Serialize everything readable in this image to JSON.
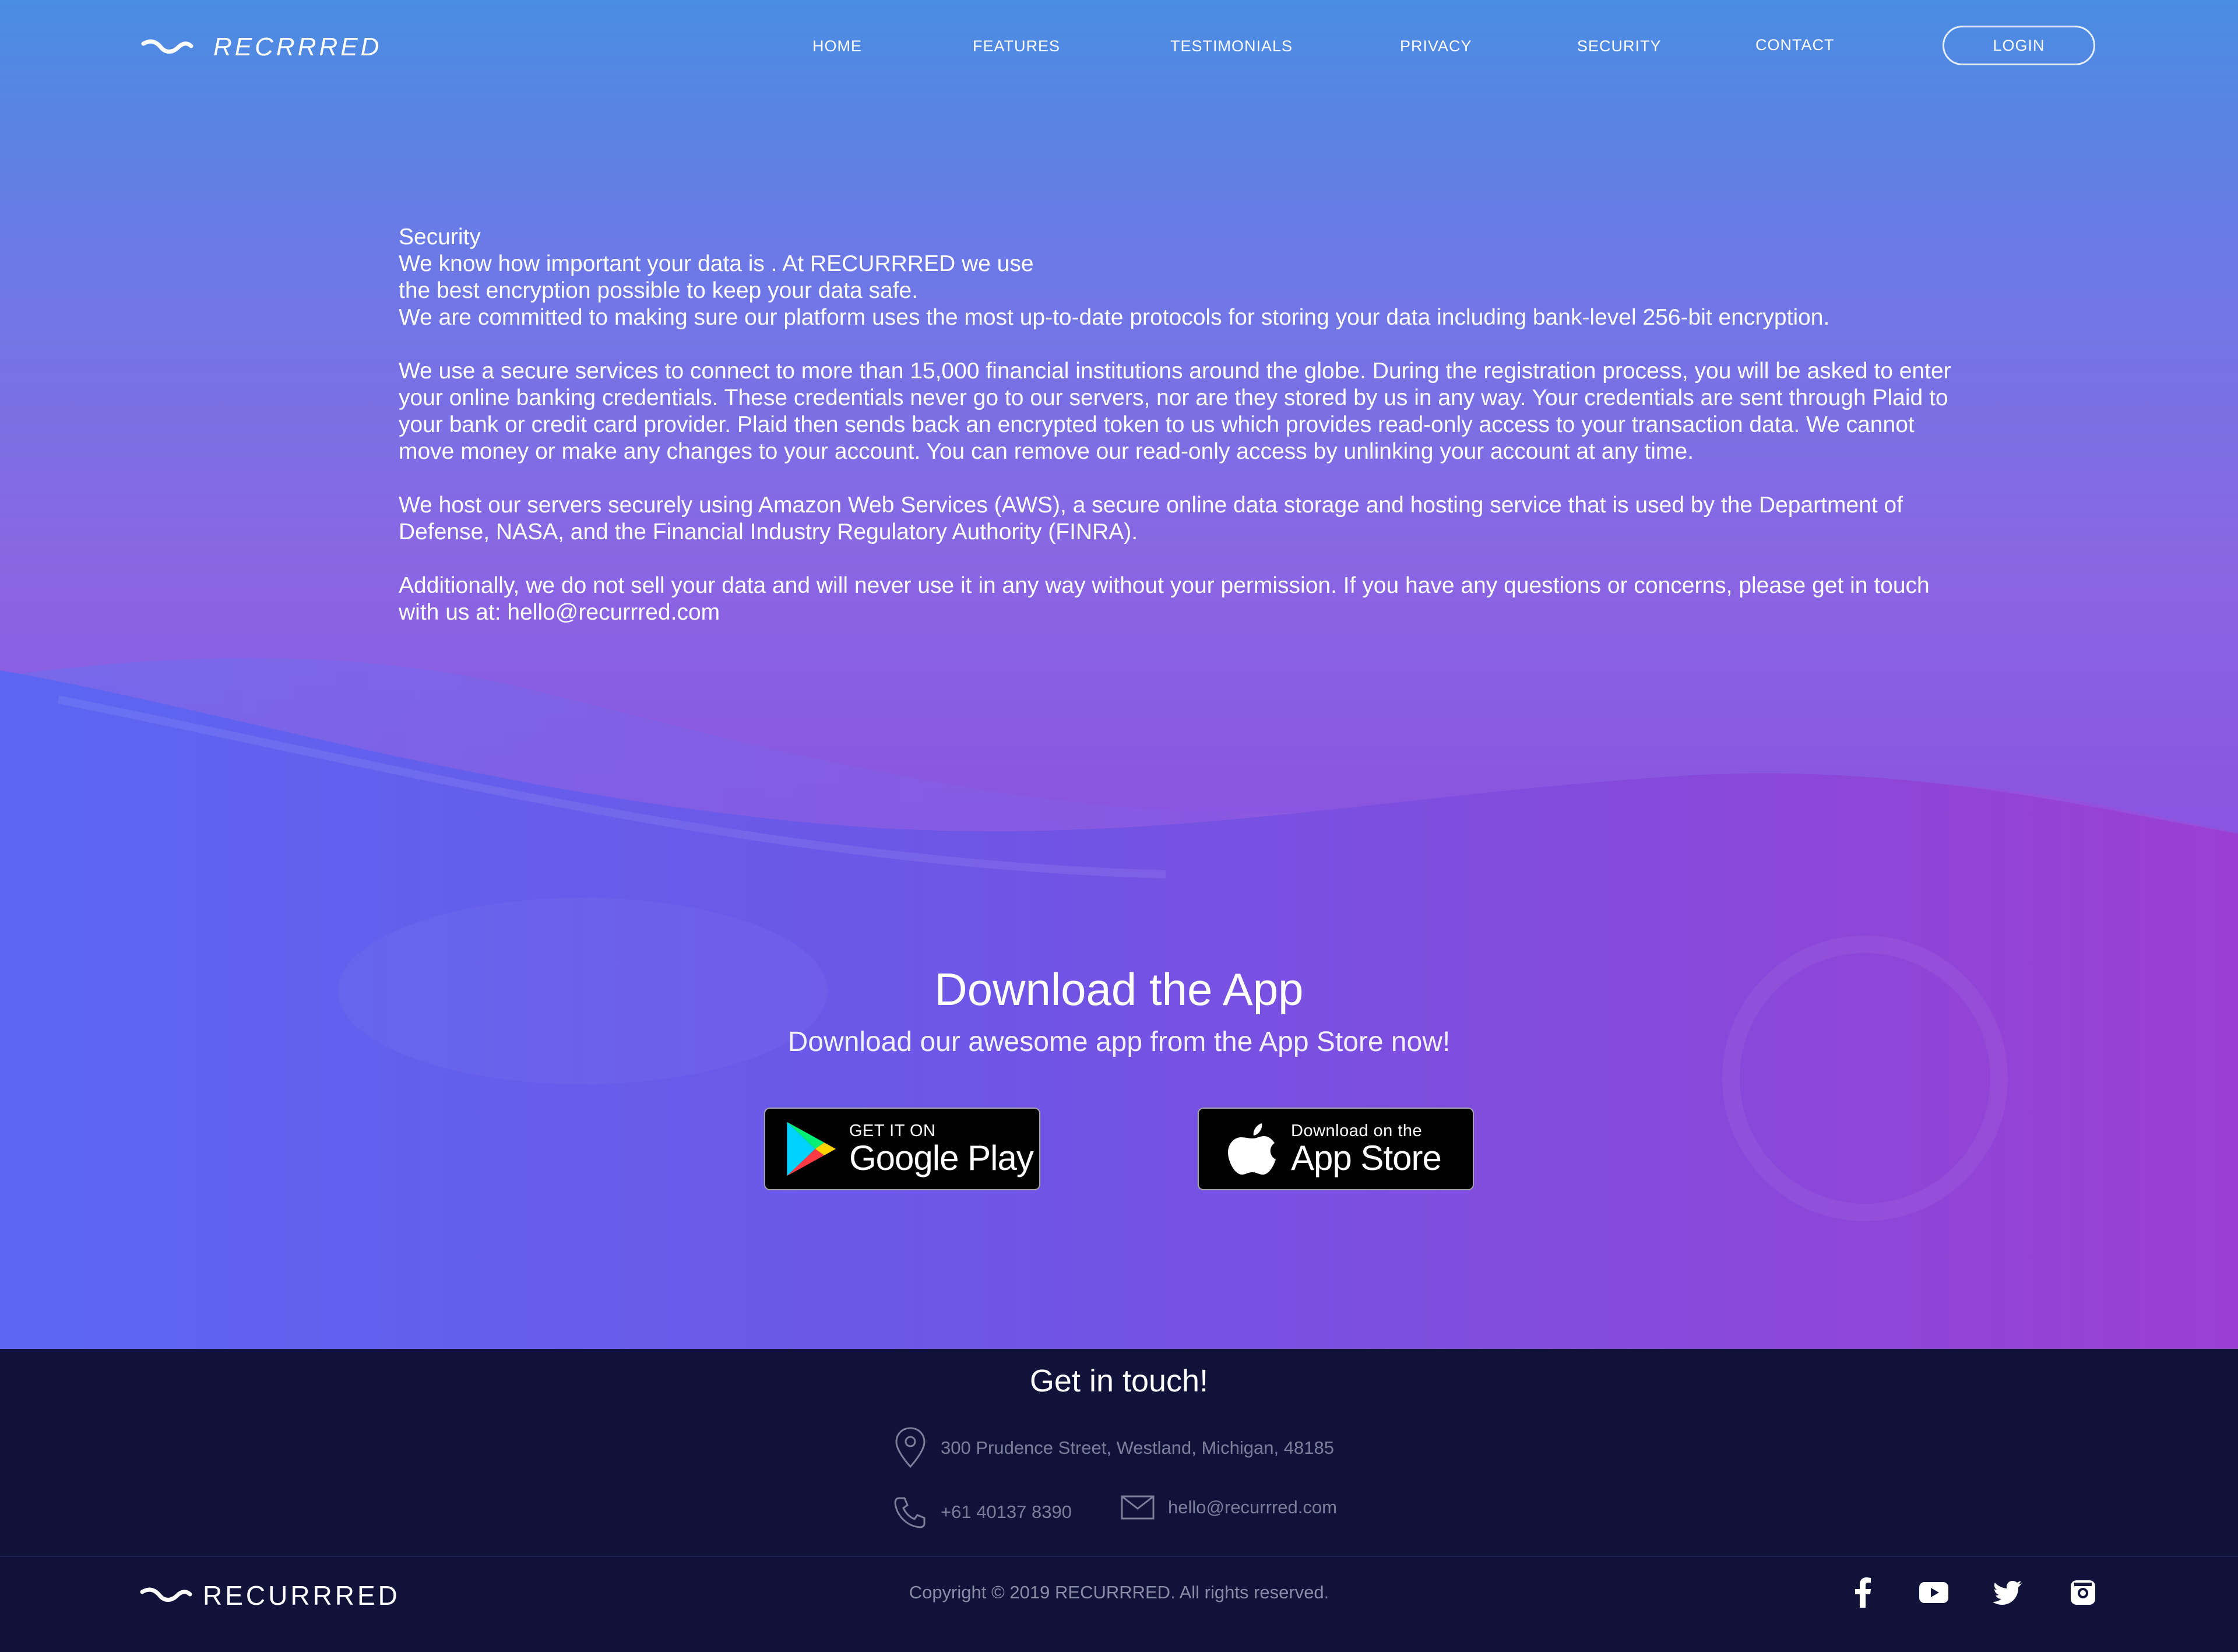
{
  "nav": {
    "logo_text": "RECRRRED",
    "links": [
      "HOME",
      "FEATURES",
      "TESTIMONIALS",
      "PRIVACY",
      "SECURITY",
      "CONTACT"
    ],
    "login_label": "LOGIN"
  },
  "security": {
    "heading": "Security",
    "intro_line1": "We know how important your data is . At RECURRRED we use",
    "intro_line2": "the best encryption possible to keep your data safe.",
    "intro_line3": "We are committed to making sure our platform uses the most up-to-date protocols for storing your data including bank-level 256-bit encryption.",
    "para2_line1": "We use a secure services to connect to more than 15,000 financial institutions around the globe. During the registration process, you will be asked to enter",
    "para2_line2": "your online banking credentials. These credentials never go to our servers, nor are they stored by us in any way. Your credentials are sent through Plaid to",
    "para2_line3": "your bank or credit card provider. Plaid then sends back an encrypted token to us which provides read-only access to your transaction data. We cannot",
    "para2_line4": "move money or make any changes to your account. You can remove our read-only access by unlinking your account at any time.",
    "para3_line1": "We host our servers securely using Amazon Web Services (AWS), a secure online data storage and hosting service that is used by the Department of",
    "para3_line2": "Defense, NASA, and the Financial Industry Regulatory Authority (FINRA).",
    "para4_line1": "Additionally, we do not sell your data and will never use it in any way without your permission. If you have any questions or concerns, please get in touch",
    "para4_line2": "with us at: hello@recurrred.com"
  },
  "download": {
    "title": "Download the App",
    "subtitle": "Download our awesome app from the App Store now!",
    "google_small": "GET IT ON",
    "google_big": "Google Play",
    "apple_small": "Download on the",
    "apple_big": "App Store"
  },
  "footer": {
    "title": "Get in touch!",
    "address": "300  Prudence Street, Westland, Michigan, 48185",
    "phone": "+61 40137 8390",
    "email": "hello@recurrred.com",
    "logo_text": "RECURRRED",
    "copyright": "Copyright  © 2019 RECURRRED. All rights reserved.",
    "social_icons": [
      "facebook-icon",
      "youtube-icon",
      "twitter-icon",
      "instagram-icon"
    ]
  },
  "colors": {
    "hero_top": "#4a8de2",
    "hero_mid": "#8a66e3",
    "wave_blue": "#5b62f0",
    "wave_purple": "#9b3fd2",
    "footer_bg": "#10123a"
  }
}
